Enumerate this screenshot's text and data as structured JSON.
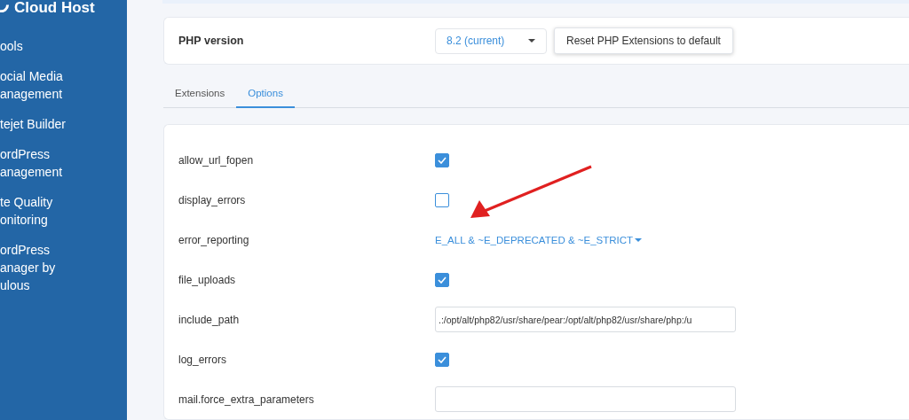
{
  "sidebar": {
    "logo": "Cloud Host",
    "items": [
      {
        "label": "ools"
      },
      {
        "label": "ocial Media\nanagement"
      },
      {
        "label": "tejet Builder"
      },
      {
        "label": "ordPress\nanagement"
      },
      {
        "label": "te Quality\nonitoring"
      },
      {
        "label": "ordPress\nanager by\nulous"
      }
    ]
  },
  "php_version": {
    "label": "PHP version",
    "value": "8.2 (current)",
    "reset_button": "Reset PHP Extensions to default"
  },
  "tabs": [
    {
      "label": "Extensions",
      "selected": false
    },
    {
      "label": "Options",
      "selected": true
    }
  ],
  "options": [
    {
      "name": "allow_url_fopen",
      "kind": "checkbox",
      "checked": true
    },
    {
      "name": "display_errors",
      "kind": "checkbox",
      "checked": false
    },
    {
      "name": "error_reporting",
      "kind": "dropdown",
      "value": "E_ALL & ~E_DEPRECATED & ~E_STRICT"
    },
    {
      "name": "file_uploads",
      "kind": "checkbox",
      "checked": true
    },
    {
      "name": "include_path",
      "kind": "text",
      "value": ".:/opt/alt/php82/usr/share/pear:/opt/alt/php82/usr/share/php:/u"
    },
    {
      "name": "log_errors",
      "kind": "checkbox",
      "checked": true
    },
    {
      "name": "mail.force_extra_parameters",
      "kind": "text"
    }
  ]
}
